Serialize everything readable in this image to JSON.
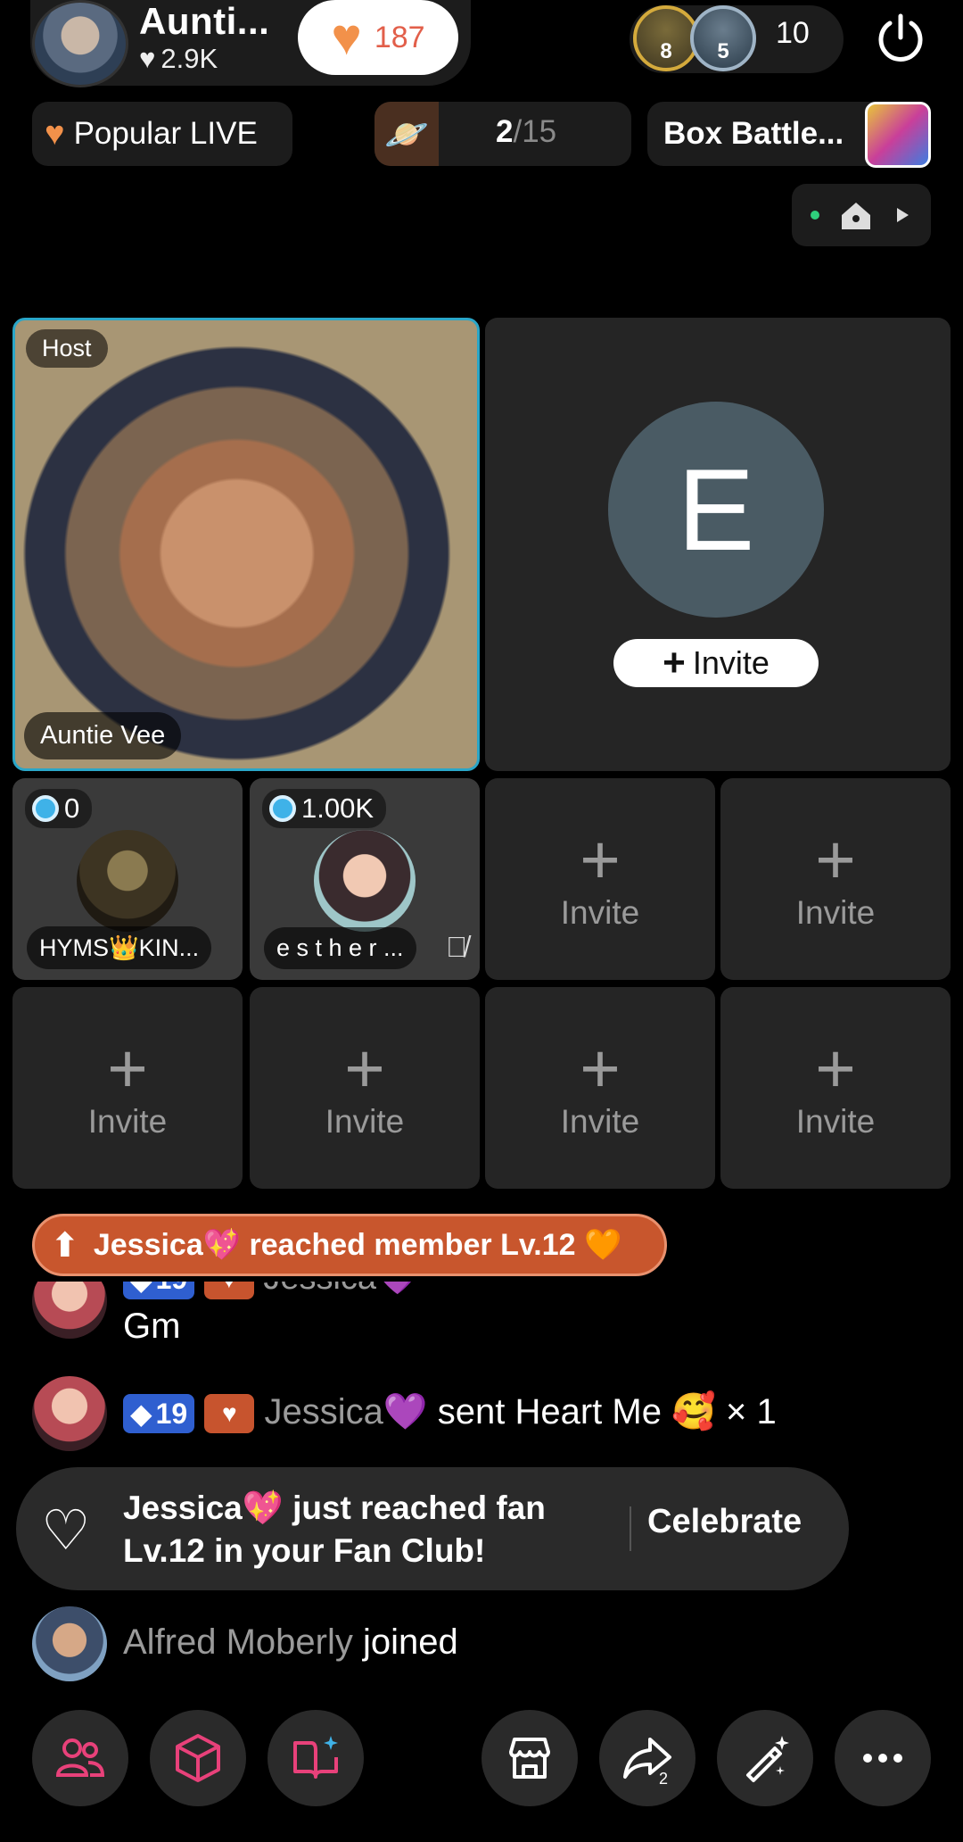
{
  "host": {
    "name": "Aunti...",
    "likes": "2.9K",
    "like_count": "187"
  },
  "viewers": {
    "badge1": "8",
    "badge2": "5",
    "count": "10"
  },
  "pills": {
    "popular": "Popular LIVE",
    "rank_current": "2",
    "rank_total": "/15",
    "box_battle": "Box Battle..."
  },
  "grid": {
    "host_label": "Host",
    "host_name": "Auntie  Vee",
    "empty_initial": "E",
    "invite_label": "Invite",
    "guests": [
      {
        "gems": "0",
        "name": "HYMS👑KIN..."
      },
      {
        "gems": "1.00K",
        "name": "e s t h e r ..."
      }
    ],
    "invite_seats": [
      "Invite",
      "Invite",
      "Invite",
      "Invite",
      "Invite",
      "Invite"
    ]
  },
  "chat": {
    "banner": "Jessica💖 reached member Lv.12 🧡",
    "partial_username": "Jessica💜",
    "partial_level": "19",
    "gm": "Gm",
    "gift_level": "19",
    "gift_user": "Jessica💜",
    "gift_text": "sent Heart Me 🥰 × 1",
    "fan_message": "Jessica💖 just reached fan Lv.12 in your Fan Club!",
    "celebrate": "Celebrate",
    "joined_user": "Alfred Moberly",
    "joined_text": "joined"
  },
  "toolbar": {
    "share_count": "2",
    "icons": [
      "people-icon",
      "cube-icon",
      "book-sparkle-icon",
      "store-icon",
      "share-icon",
      "magic-wand-icon",
      "more-icon"
    ]
  },
  "colors": {
    "accent_pink": "#e8417a",
    "accent_cyan": "#2aa6c8",
    "banner_orange": "#c8562d"
  }
}
